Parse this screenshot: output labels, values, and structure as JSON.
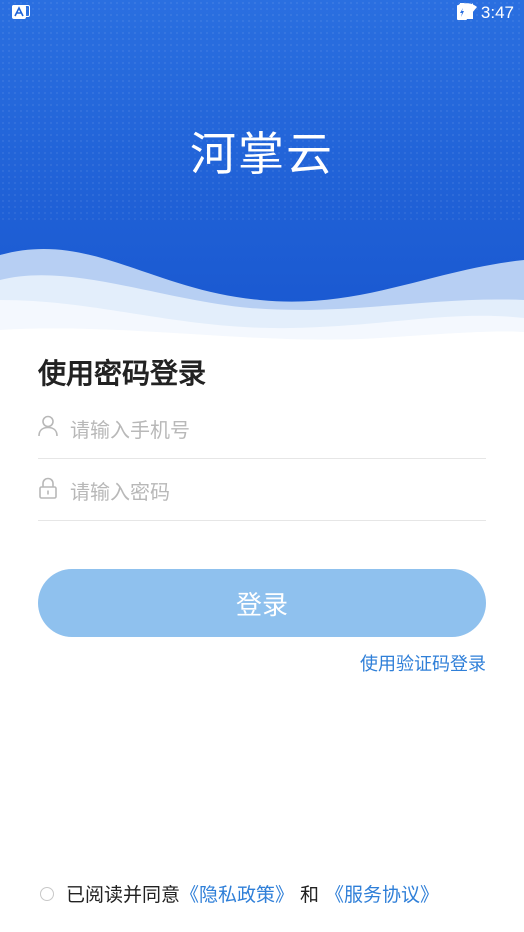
{
  "status_bar": {
    "left_icons": [
      "keyboard-icon",
      "app-notification-icon"
    ],
    "right_icons": [
      "location-icon",
      "wifi-icon",
      "signal-icon",
      "battery-icon"
    ],
    "time": "3:47"
  },
  "header": {
    "app_name": "河掌云"
  },
  "login_form": {
    "title": "使用密码登录",
    "phone_placeholder": "请输入手机号",
    "password_placeholder": "请输入密码",
    "login_label": "登录",
    "sms_login_link": "使用验证码登录"
  },
  "agreement": {
    "prefix": "已阅读并同意",
    "privacy_link": "《隐私政策》",
    "conjunction": "和",
    "service_link": "《服务协议》"
  },
  "colors": {
    "hero_blue": "#1f63d8",
    "button": "#8fc1ee",
    "link": "#2f7fd8"
  }
}
